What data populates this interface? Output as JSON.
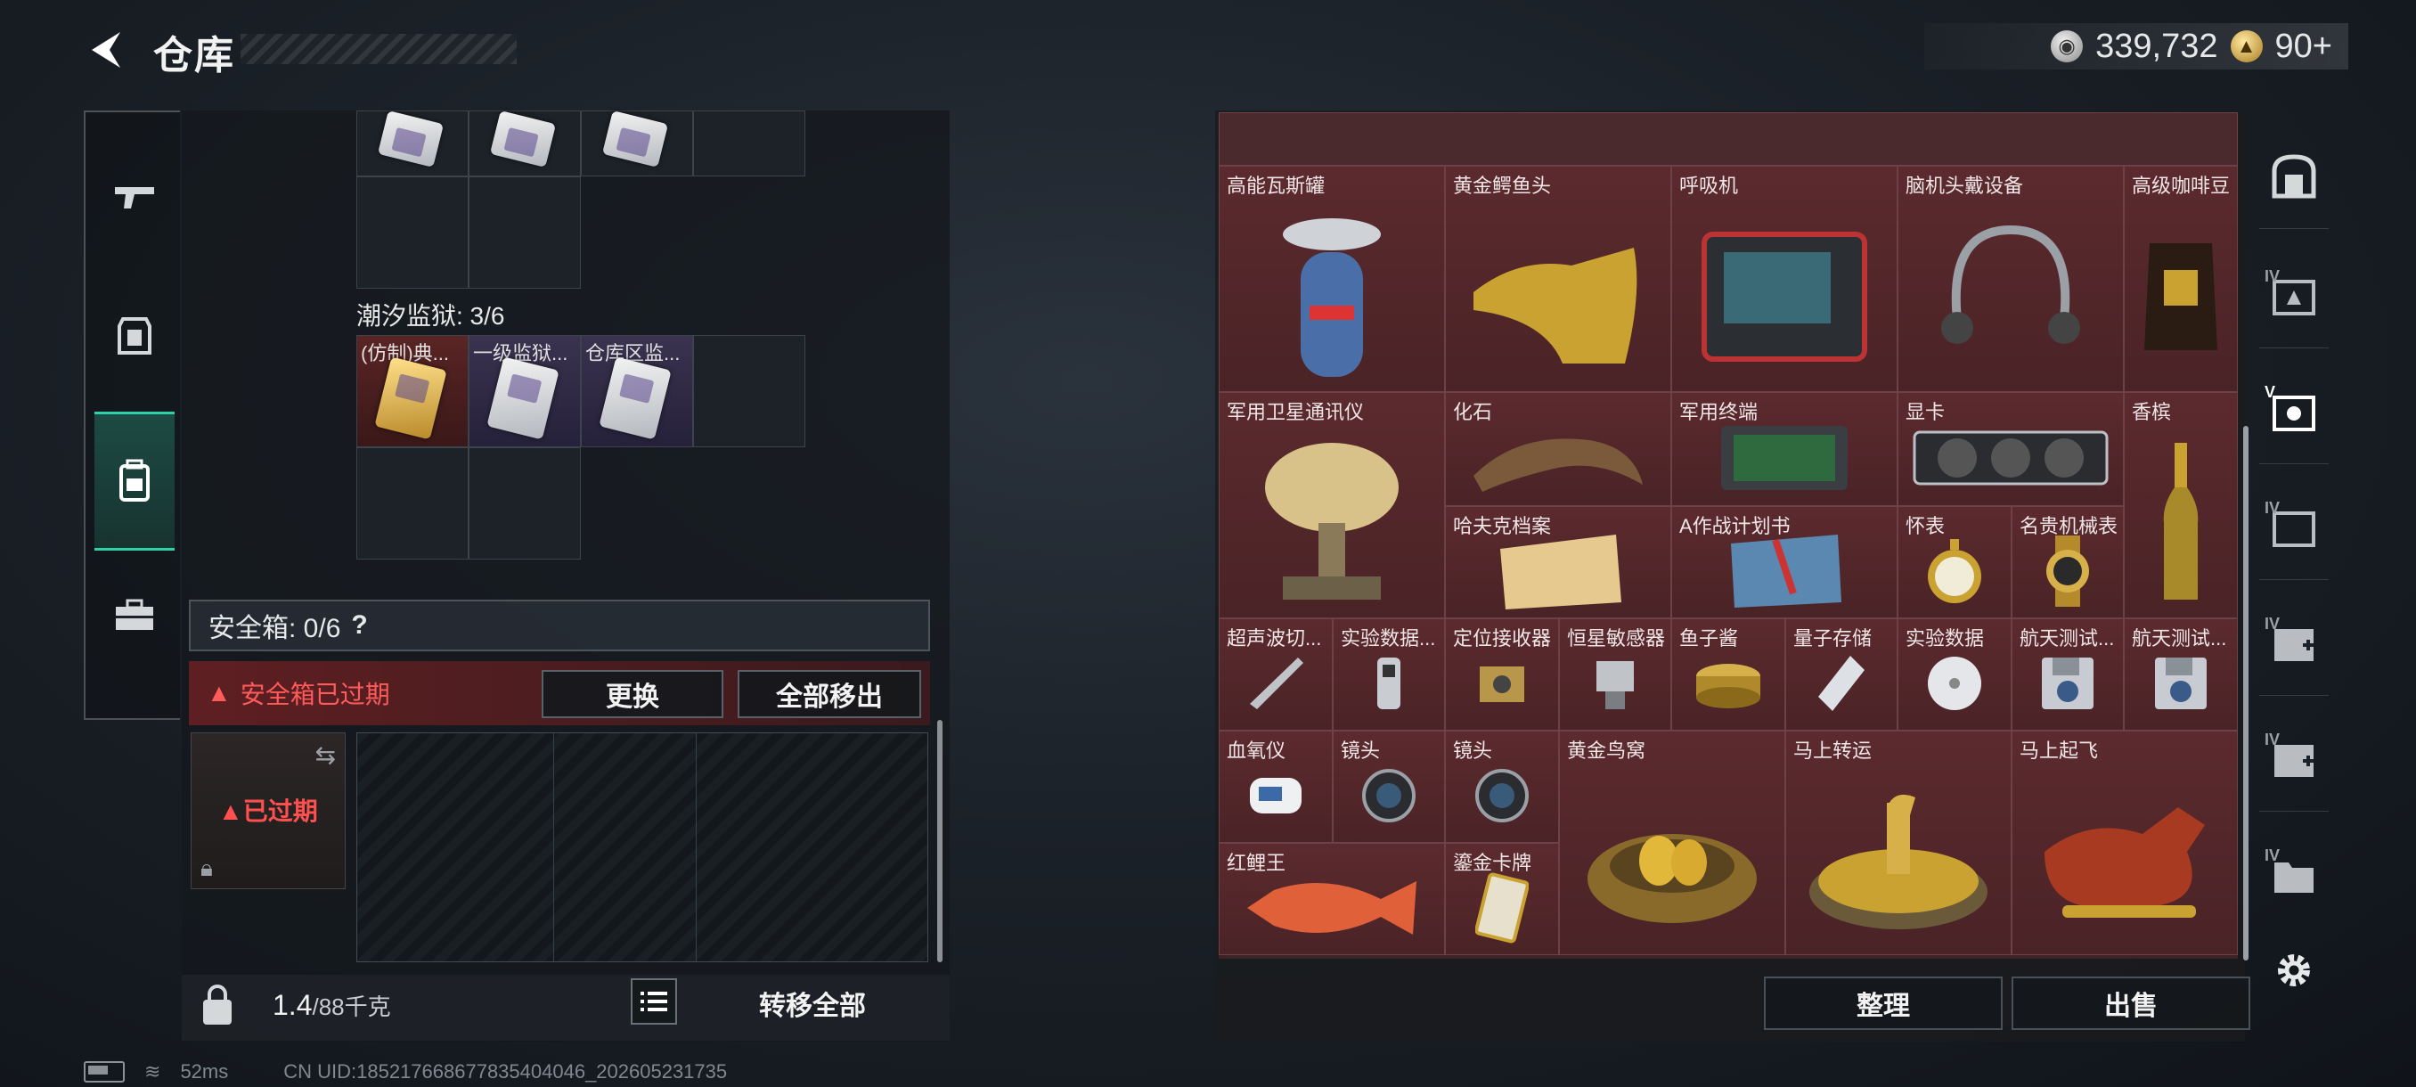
{
  "header": {
    "back_icon": "back-arrow-icon",
    "title": "仓库"
  },
  "currency": {
    "silver_amount": "339,732",
    "gold_amount": "90",
    "gold_plus": "+"
  },
  "left_tabs": [
    {
      "name": "weapon-tab",
      "icon": "gun-icon"
    },
    {
      "name": "armor-tab",
      "icon": "armor-icon"
    },
    {
      "name": "backpack-tab",
      "icon": "backpack-icon",
      "active": true
    },
    {
      "name": "toolbox-tab",
      "icon": "toolbox-icon"
    }
  ],
  "container": {
    "section_title": "潮汐监狱: 3/6",
    "items": [
      {
        "label": "(仿制)典...",
        "rarity": "red"
      },
      {
        "label": "一级监狱...",
        "rarity": "purple"
      },
      {
        "label": "仓库区监...",
        "rarity": "purple"
      }
    ]
  },
  "safebox": {
    "label": "安全箱: 0/6",
    "help": "?",
    "warning": "安全箱已过期",
    "replace_button": "更换",
    "move_all_button": "全部移出",
    "expired_badge": "已过期"
  },
  "bottom": {
    "weight_value": "1.4",
    "weight_unit": "/88千克",
    "transfer_all_button": "转移全部"
  },
  "right_grid": {
    "items": [
      {
        "label": "高能瓦斯罐",
        "icon": "gas-canister-icon"
      },
      {
        "label": "黄金鳄鱼头",
        "icon": "golden-crocodile-icon"
      },
      {
        "label": "呼吸机",
        "icon": "ventilator-icon"
      },
      {
        "label": "脑机头戴设备",
        "icon": "headset-icon"
      },
      {
        "label": "高级咖啡豆",
        "icon": "coffee-bag-icon"
      },
      {
        "label": "军用卫星通讯仪",
        "icon": "satellite-dish-icon"
      },
      {
        "label": "化石",
        "icon": "fossil-claw-icon"
      },
      {
        "label": "军用终端",
        "icon": "terminal-icon"
      },
      {
        "label": "显卡",
        "icon": "graphics-card-icon"
      },
      {
        "label": "香槟",
        "icon": "champagne-icon"
      },
      {
        "label": "哈夫克档案",
        "icon": "files-icon"
      },
      {
        "label": "A作战计划书",
        "icon": "plan-book-icon"
      },
      {
        "label": "怀表",
        "icon": "pocket-watch-icon"
      },
      {
        "label": "名贵机械表",
        "icon": "wristwatch-icon"
      },
      {
        "label": "超声波切...",
        "icon": "ultrasonic-cutter-icon"
      },
      {
        "label": "实验数据...",
        "icon": "data-device-icon"
      },
      {
        "label": "定位接收器",
        "icon": "receiver-icon"
      },
      {
        "label": "恒星敏感器",
        "icon": "star-sensor-icon"
      },
      {
        "label": "鱼子酱",
        "icon": "caviar-icon"
      },
      {
        "label": "量子存储",
        "icon": "quantum-storage-icon"
      },
      {
        "label": "实验数据",
        "icon": "disc-icon"
      },
      {
        "label": "航天测试...",
        "icon": "floppy-icon"
      },
      {
        "label": "航天测试...",
        "icon": "floppy-icon"
      },
      {
        "label": "血氧仪",
        "icon": "oximeter-icon"
      },
      {
        "label": "镜头",
        "icon": "lens-icon"
      },
      {
        "label": "镜头",
        "icon": "lens-icon"
      },
      {
        "label": "黄金鸟窝",
        "icon": "golden-nest-icon"
      },
      {
        "label": "马上转运",
        "icon": "horse-wheel-icon"
      },
      {
        "label": "马上起飞",
        "icon": "red-horse-icon"
      },
      {
        "label": "红鲤王",
        "icon": "red-carp-icon"
      },
      {
        "label": "鎏金卡牌",
        "icon": "gilded-card-icon"
      }
    ]
  },
  "actions": {
    "sort_button": "整理",
    "sell_button": "出售"
  },
  "right_tabs": [
    {
      "name": "case-tab",
      "icon": "helmet-case-icon",
      "roman": ""
    },
    {
      "name": "tab-iv-1",
      "icon": "box-icon",
      "roman": "IV"
    },
    {
      "name": "tab-v",
      "icon": "box-active-icon",
      "roman": "V",
      "active": true
    },
    {
      "name": "tab-iv-2",
      "icon": "box-icon",
      "roman": "IV"
    },
    {
      "name": "tab-iv-3",
      "icon": "box-plus-icon",
      "roman": "IV"
    },
    {
      "name": "tab-iv-4",
      "icon": "box-plus-icon",
      "roman": "IV"
    },
    {
      "name": "tab-iv-5",
      "icon": "folder-icon",
      "roman": "IV"
    },
    {
      "name": "settings",
      "icon": "gear-icon",
      "roman": ""
    }
  ],
  "status": {
    "ping": "52ms",
    "uid": "CN UID:18521766867783540404​6_202605231735"
  }
}
